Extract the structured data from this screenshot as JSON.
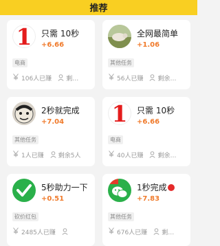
{
  "header": {
    "title": "推荐"
  },
  "cards": [
    {
      "title": "只需 10秒",
      "reward": "+6.66",
      "tag": "电商",
      "earned": "106人已赚",
      "remaining": "剩…",
      "icon": "red-digit-one-icon"
    },
    {
      "title": "全网最简单",
      "reward": "+1.06",
      "tag": "其他任务",
      "earned": "56人已赚",
      "remaining": "剩余…",
      "icon": "sheep-photo-icon"
    },
    {
      "title": "2秒就完成",
      "reward": "+7.04",
      "tag": "其他任务",
      "earned": "1人已赚",
      "remaining": "剩余5人",
      "icon": "meme-face-icon"
    },
    {
      "title": "只需 10秒",
      "reward": "+6.66",
      "tag": "电商",
      "earned": "40人已赚",
      "remaining": "剩余…",
      "icon": "red-digit-one-icon"
    },
    {
      "title": "5秒助力一下",
      "reward": "+0.51",
      "tag": "砍价红包",
      "earned": "2485人已赚",
      "remaining": "",
      "icon": "green-check-icon"
    },
    {
      "title": "1秒完成",
      "reward": "+7.83",
      "tag": "其他任务",
      "earned": "676人已赚",
      "remaining": "剩…",
      "icon": "wechat-icon"
    }
  ],
  "digit_icon_text": "1",
  "colors": {
    "header": "#f9cf22",
    "reward": "#f07a2b",
    "digit": "#e41c1c"
  }
}
